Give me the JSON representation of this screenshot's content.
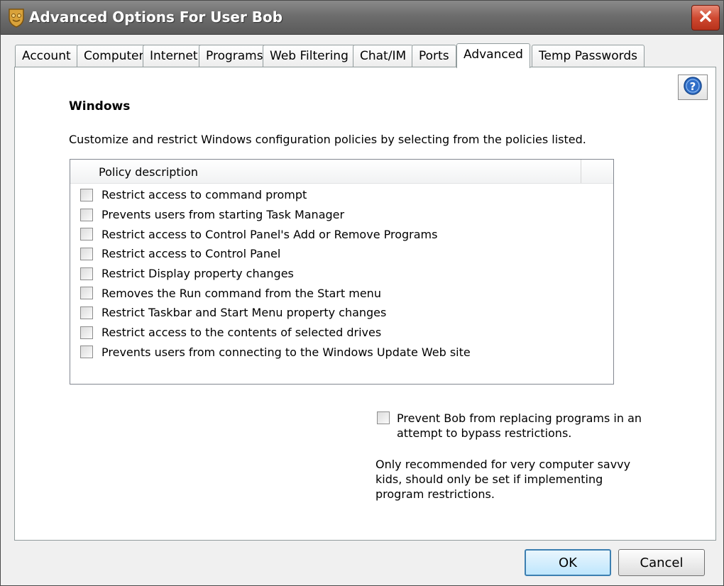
{
  "window": {
    "title": "Advanced Options For User Bob",
    "app_icon": "shield-icon",
    "close_icon": "close-icon"
  },
  "tabs": [
    {
      "label": "Account"
    },
    {
      "label": "Computer"
    },
    {
      "label": "Internet"
    },
    {
      "label": "Programs"
    },
    {
      "label": "Web Filtering"
    },
    {
      "label": "Chat/IM"
    },
    {
      "label": "Ports"
    },
    {
      "label": "Advanced",
      "active": true
    },
    {
      "label": "Temp Passwords"
    }
  ],
  "help": {
    "icon": "help-icon"
  },
  "section": {
    "title": "Windows",
    "description": "Customize and restrict Windows configuration policies by selecting from the policies listed."
  },
  "policy_list": {
    "column_header": "Policy description",
    "items": [
      {
        "label": "Restrict access to command prompt",
        "checked": false
      },
      {
        "label": "Prevents users from starting Task Manager",
        "checked": false
      },
      {
        "label": "Restrict access to Control Panel's Add or Remove Programs",
        "checked": false
      },
      {
        "label": "Restrict access to Control Panel",
        "checked": false
      },
      {
        "label": "Restrict Display property changes",
        "checked": false
      },
      {
        "label": "Removes the Run command from the Start menu",
        "checked": false
      },
      {
        "label": "Restrict Taskbar and Start Menu property changes",
        "checked": false
      },
      {
        "label": "Restrict access to the contents of selected drives",
        "checked": false
      },
      {
        "label": "Prevents users from connecting to the Windows Update Web site",
        "checked": false
      }
    ]
  },
  "prevent_replace": {
    "label": "Prevent Bob from replacing programs in an attempt to bypass restrictions.",
    "checked": false
  },
  "note": "Only recommended for very computer savvy kids, should only be set if implementing program restrictions.",
  "buttons": {
    "ok_label": "OK",
    "cancel_label": "Cancel"
  },
  "colors": {
    "title_bar": "#6d6d6d",
    "close_button": "#cf4a32",
    "ok_border": "#3c7fb1",
    "help_icon": "#2f6ec8"
  }
}
